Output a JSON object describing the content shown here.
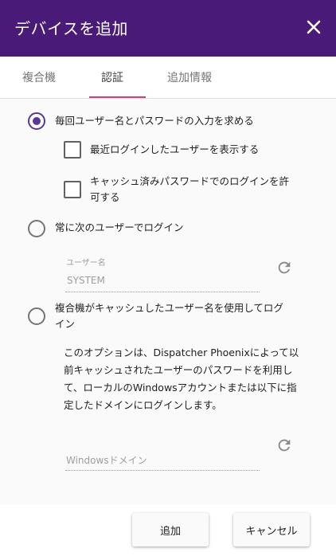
{
  "dialog": {
    "title": "デバイスを追加",
    "colors": {
      "titlebar": "#4a1a78",
      "accent": "#d63b78",
      "radio": "#5a3a8f"
    }
  },
  "tabs": [
    {
      "label": "複合機"
    },
    {
      "label": "認証",
      "selected": true
    },
    {
      "label": "追加情報"
    }
  ],
  "options": {
    "prompt_each_time": {
      "label": "毎回ユーザー名とパスワードの入力を求める",
      "selected": true
    },
    "show_recent_login": {
      "label": "最近ログインしたユーザーを表示する",
      "checked": false
    },
    "allow_cached_password": {
      "line1": "キャッシュ済みパスワードでのログインを許",
      "line2": "可する",
      "checked": false
    },
    "always_login_as": {
      "label": "常に次のユーザーでログイン",
      "selected": false
    },
    "username_field": {
      "label": "ユーザー名",
      "value": "SYSTEM",
      "icon": "refresh-icon"
    },
    "use_cached_username": {
      "line1": "複合機がキャッシュしたユーザー名を使用してログ",
      "line2": "イン",
      "selected": false
    },
    "description": [
      "このオプションは、Dispatcher Phoenixによって以",
      "前キャッシュされたユーザーのパスワードを利用し",
      "て、ローカルのWindowsアカウントまたは以下に指",
      "定したドメインにログインします。"
    ],
    "domain_field": {
      "placeholder": "Windowsドメイン",
      "icon": "refresh-icon"
    }
  },
  "footer": {
    "add_label": "追加",
    "cancel_label": "キャンセル"
  }
}
